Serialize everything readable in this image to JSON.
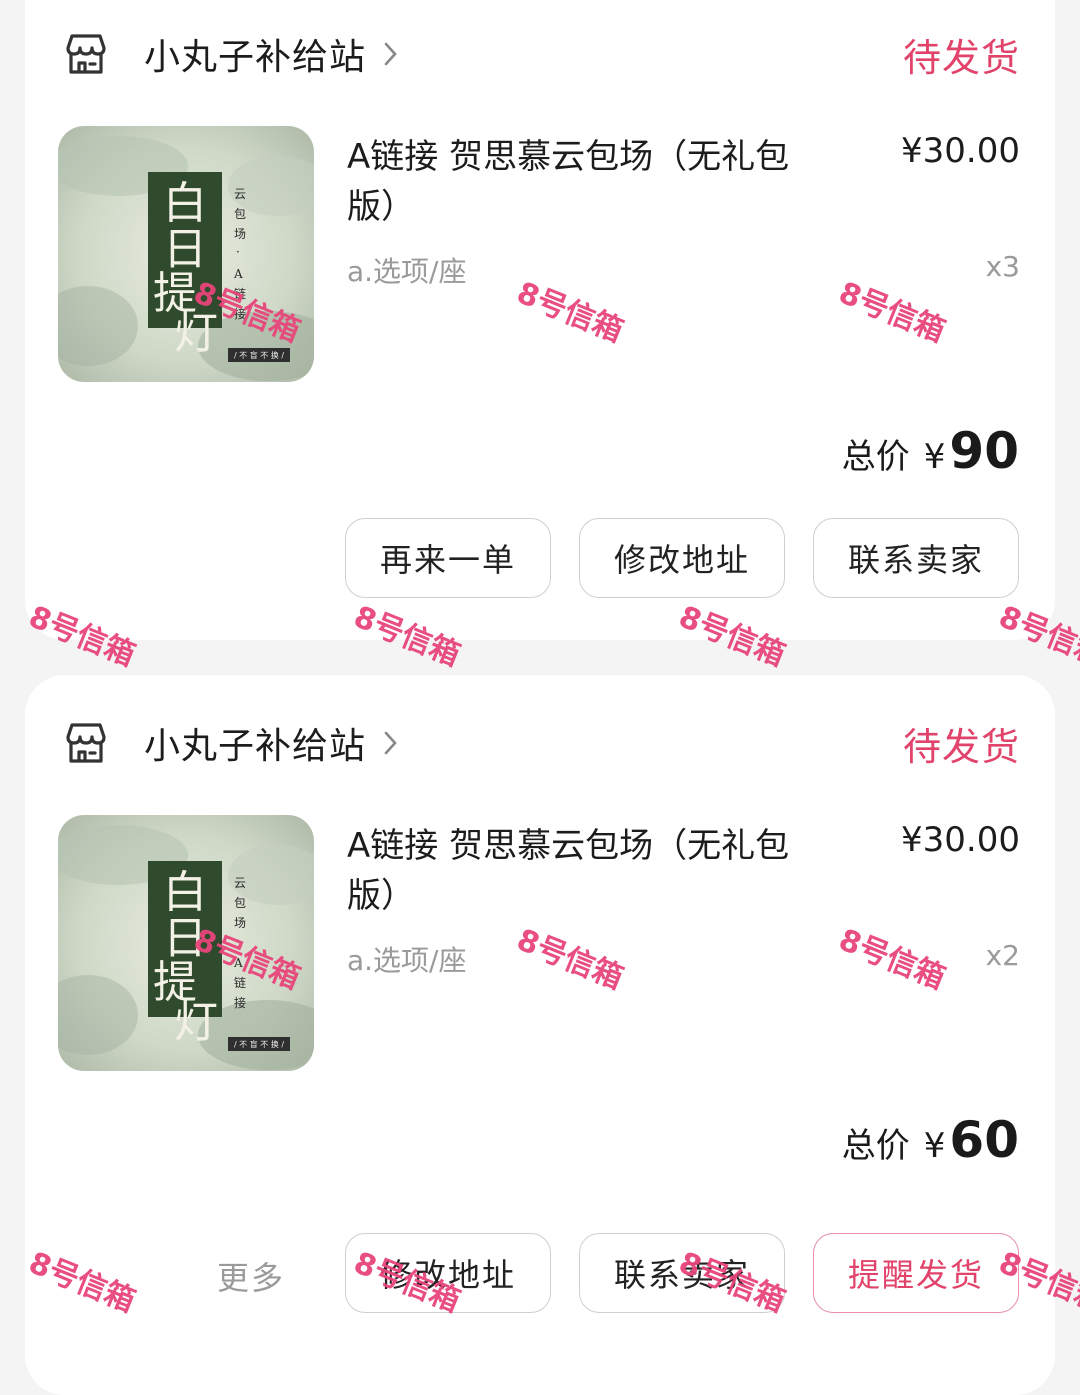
{
  "orders": [
    {
      "shop_name": "小丸子补给站",
      "status": "待发货",
      "product_title": "A链接 贺思慕云包场（无礼包版）",
      "price": "¥30.00",
      "option": "a.选项/座",
      "quantity": "x3",
      "total_label": "总价",
      "total_currency": "¥",
      "total_amount": "90",
      "buttons": [
        "再来一单",
        "修改地址",
        "联系卖家"
      ]
    },
    {
      "shop_name": "小丸子补给站",
      "status": "待发货",
      "product_title": "A链接 贺思慕云包场（无礼包版）",
      "price": "¥30.00",
      "option": "a.选项/座",
      "quantity": "x2",
      "total_label": "总价",
      "total_currency": "¥",
      "total_amount": "60",
      "more_label": "更多",
      "buttons": [
        "修改地址",
        "联系卖家",
        "提醒发货"
      ]
    }
  ],
  "poster": {
    "title": "白日提灯",
    "subtitle": "云包场·A链接",
    "tag": "/ 不 盲 不 换 /"
  },
  "watermark": "8号信箱",
  "colors": {
    "status": "#e1436a",
    "accent_border": "#e88fa6",
    "background": "#f4f4f4"
  },
  "icons": {
    "shop": "shop-icon",
    "chevron": "chevron-right-icon"
  }
}
